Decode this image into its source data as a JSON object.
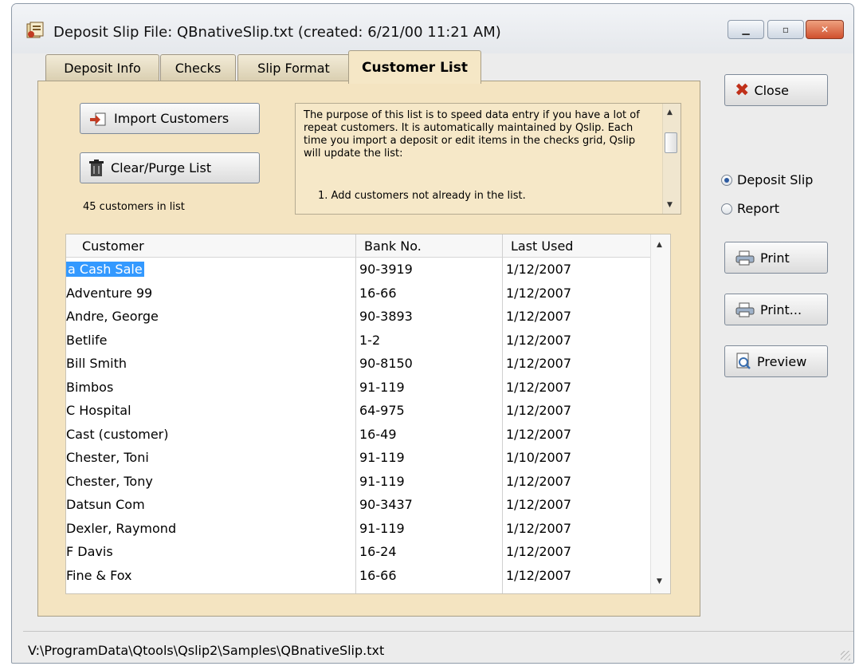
{
  "window": {
    "title": "Deposit Slip File:  QBnativeSlip.txt  (created: 6/21/00 11:21 AM)"
  },
  "tabs": [
    {
      "label": "Deposit Info"
    },
    {
      "label": "Checks"
    },
    {
      "label": "Slip Format"
    },
    {
      "label": "Customer List"
    }
  ],
  "customer_list": {
    "import_button": "Import Customers",
    "clear_button": "Clear/Purge List",
    "count_text": "45 customers in list",
    "info_text": "The purpose of this list is to speed data entry if you have a lot of repeat customers. It is automatically maintained by Qslip. Each time you import a deposit or edit items in the checks grid, Qslip will update the list:",
    "info_text_line2": "1. Add customers not already in the list."
  },
  "grid": {
    "headers": [
      "Customer",
      "Bank No.",
      "Last Used"
    ],
    "rows": [
      [
        "a Cash Sale",
        "90-3919",
        "1/12/2007"
      ],
      [
        "Adventure 99",
        "16-66",
        "1/12/2007"
      ],
      [
        "Andre, George",
        "90-3893",
        "1/12/2007"
      ],
      [
        "Betlife",
        "1-2",
        "1/12/2007"
      ],
      [
        "Bill Smith",
        "90-8150",
        "1/12/2007"
      ],
      [
        "Bimbos",
        "91-119",
        "1/12/2007"
      ],
      [
        "C Hospital",
        "64-975",
        "1/12/2007"
      ],
      [
        "Cast (customer)",
        "16-49",
        "1/12/2007"
      ],
      [
        "Chester, Toni",
        "91-119",
        "1/10/2007"
      ],
      [
        "Chester, Tony",
        "91-119",
        "1/12/2007"
      ],
      [
        "Datsun Com",
        "90-3437",
        "1/12/2007"
      ],
      [
        "Dexler, Raymond",
        "91-119",
        "1/12/2007"
      ],
      [
        "F Davis",
        "16-24",
        "1/12/2007"
      ],
      [
        "Fine & Fox",
        "16-66",
        "1/12/2007"
      ]
    ],
    "selected_row": 0
  },
  "right_panel": {
    "close_button": "Close",
    "radio_deposit": "Deposit Slip",
    "radio_report": "Report",
    "selected_radio": "Deposit Slip",
    "print_button": "Print",
    "print_dialog_button": "Print...",
    "preview_button": "Preview"
  },
  "status": {
    "path": "V:\\ProgramData\\Qtools\\Qslip2\\Samples\\QBnativeSlip.txt"
  },
  "colors": {
    "panel_bg": "#f4e4c1",
    "selection": "#3399ff",
    "close_red": "#c0301a"
  }
}
